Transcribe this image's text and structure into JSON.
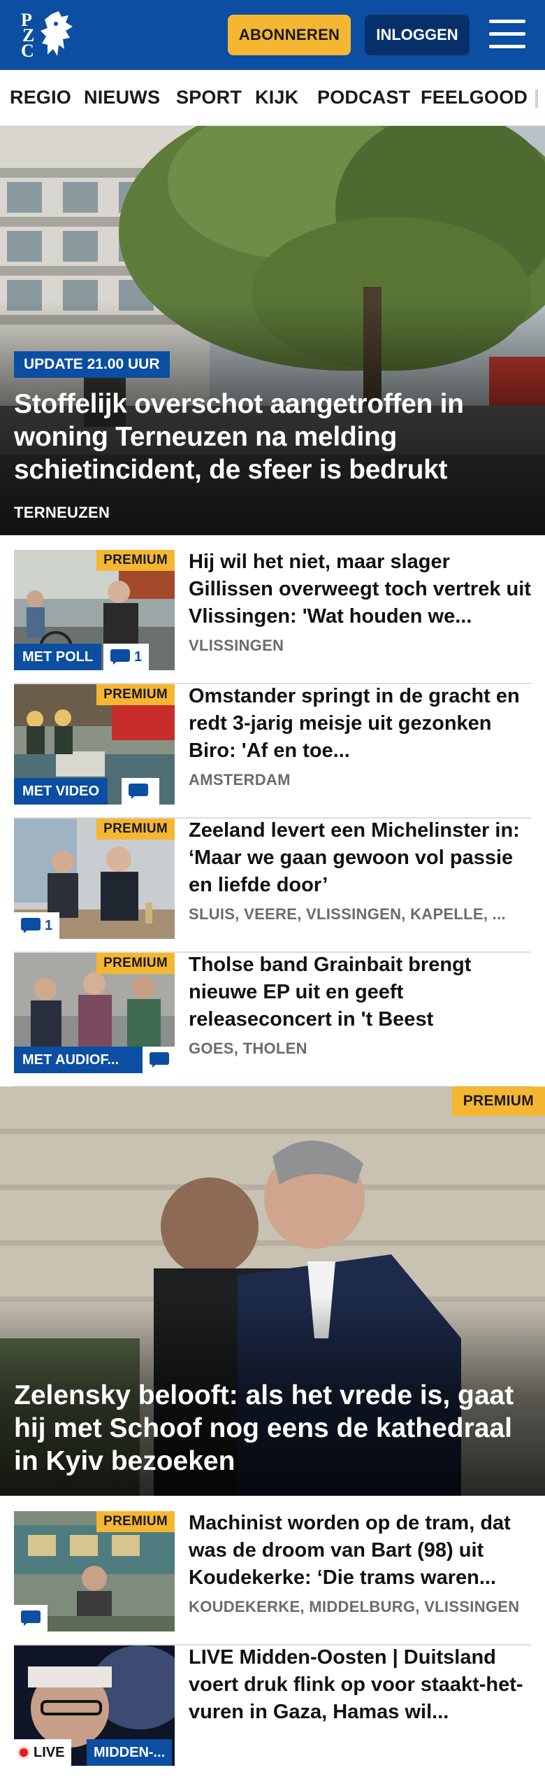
{
  "header": {
    "logo_letters": [
      "P",
      "Z",
      "C"
    ],
    "subscribe_label": "ABONNEREN",
    "login_label": "INLOGGEN",
    "colors": {
      "brand_blue": "#0b4ea2",
      "accent_yellow": "#f5b731",
      "dark_blue": "#07306b"
    }
  },
  "nav": {
    "items": [
      "REGIO",
      "NIEUWS",
      "SPORT",
      "KIJK",
      "PODCAST",
      "FEELGOOD"
    ]
  },
  "hero": {
    "tag": "UPDATE 21.00 UUR",
    "title": "Stoffelijk overschot aangetroffen in woning Terneuzen na melding schietincident, de sfeer is bedrukt",
    "location": "TERNEUZEN"
  },
  "articles": [
    {
      "premium": "PREMIUM",
      "badge": "MET POLL",
      "comments": "1",
      "title": "Hij wil het niet, maar slager Gillissen overweegt toch vertrek uit Vlissingen: 'Wat houden we...",
      "location": "VLISSINGEN"
    },
    {
      "premium": "PREMIUM",
      "badge": "MET VIDEO",
      "comments": "",
      "title": "Omstander springt in de gracht en redt 3-jarig meisje uit gezonken Biro: 'Af en toe...",
      "location": "AMSTERDAM"
    },
    {
      "premium": "PREMIUM",
      "badge": "",
      "comments": "1",
      "title": "Zeeland levert een Michelinster in: ‘Maar we gaan gewoon vol passie en liefde door’",
      "location": "SLUIS, VEERE, VLISSINGEN, KAPELLE, ..."
    },
    {
      "premium": "PREMIUM",
      "badge": "MET AUDIOF...",
      "comments": "",
      "title": "Tholse band Grainbait brengt nieuwe EP uit en geeft releaseconcert in 't Beest",
      "location": "GOES, THOLEN"
    }
  ],
  "big_article": {
    "premium": "PREMIUM",
    "title": "Zelensky belooft: als het vrede is, gaat hij met Schoof nog eens de kathedraal in Kyiv bezoeken"
  },
  "articles2": [
    {
      "premium": "PREMIUM",
      "title": "Machinist worden op de tram, dat was de droom van Bart (98) uit Koudekerke: ‘Die trams waren...",
      "location": "KOUDEKERKE, MIDDELBURG, VLISSINGEN"
    },
    {
      "live_label": "LIVE",
      "category": "MIDDEN-...",
      "title": "LIVE Midden-Oosten | Duitsland voert druk flink op voor staakt-het-vuren in Gaza, Hamas wil..."
    }
  ]
}
